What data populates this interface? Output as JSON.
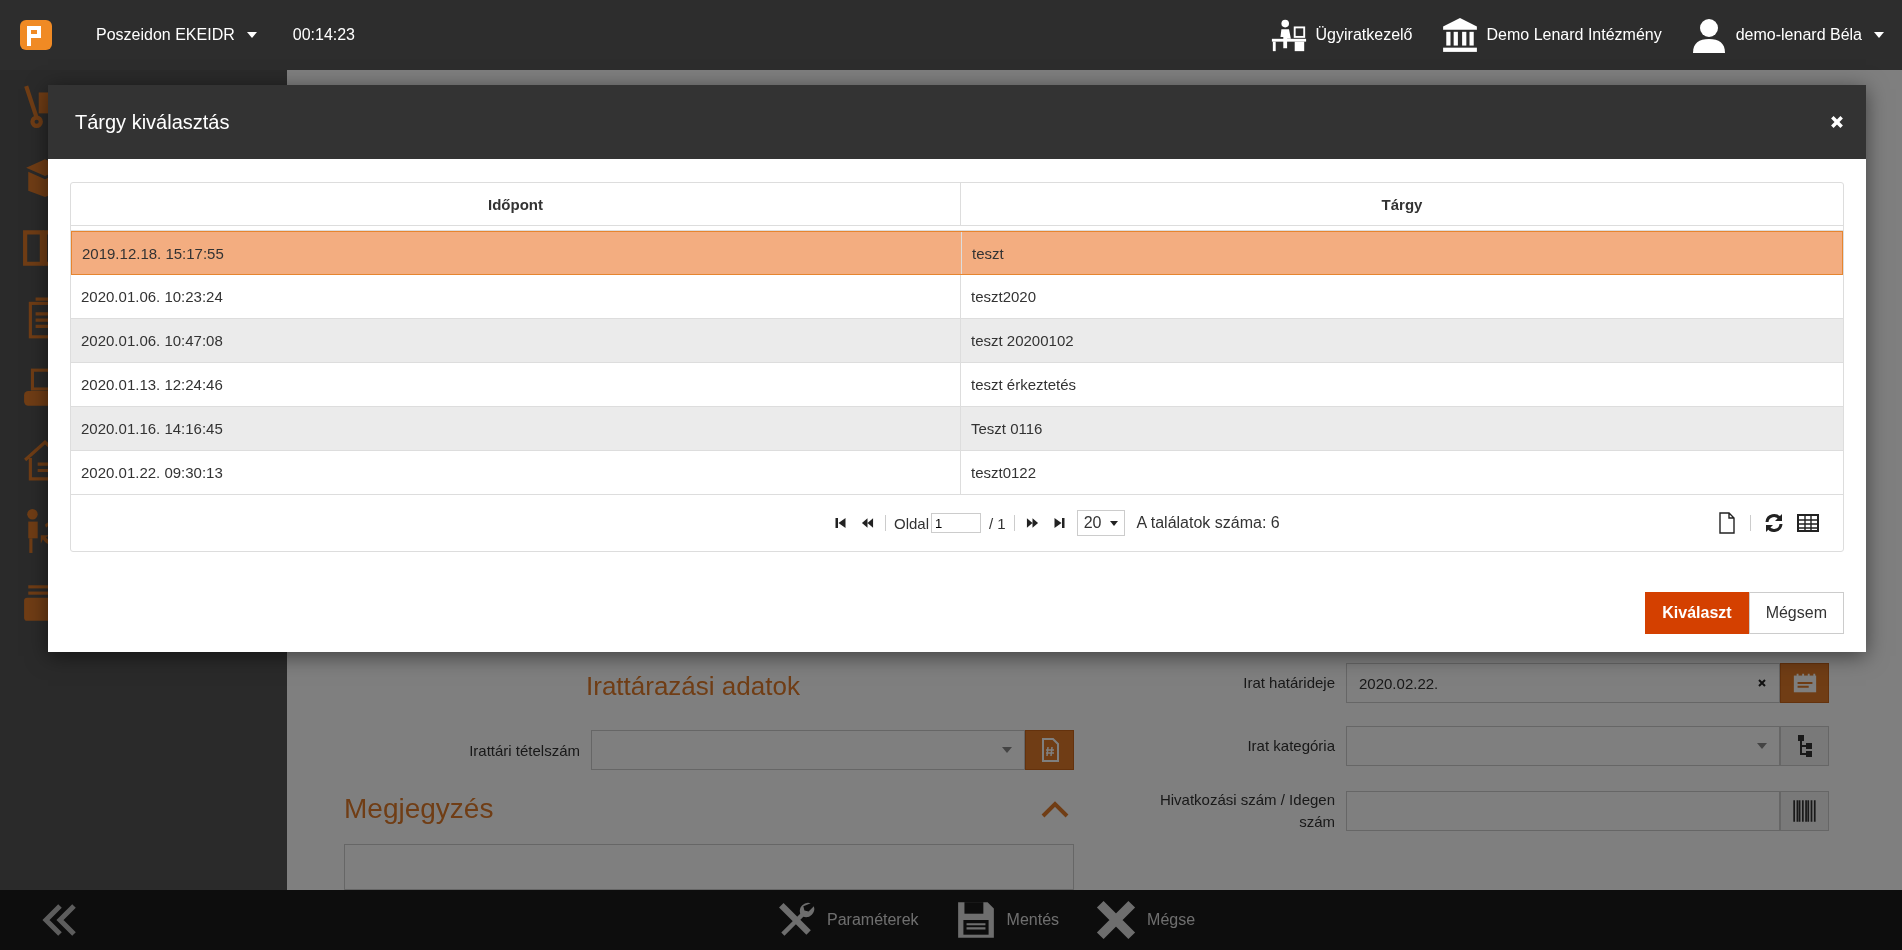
{
  "top_bar": {
    "app_name": "Poszeidon EKEIDR",
    "timer": "00:14:23",
    "module": "Ügyiratkezelő",
    "institution": "Demo Lenard Intézmény",
    "user": "demo-lenard Béla"
  },
  "form": {
    "archive_heading": "Irattárazási adatok",
    "left_fields": [
      {
        "label": "Irattári tételszám",
        "kind": "number-select"
      }
    ],
    "note_heading": "Megjegyzés",
    "right_fields": [
      {
        "label": "Irat határideje",
        "kind": "date",
        "value": "2020.02.22."
      },
      {
        "label": "Irat kategória",
        "kind": "tree-select"
      },
      {
        "label": "Hivatkozási szám / Idegen szám",
        "kind": "barcode"
      }
    ]
  },
  "modal": {
    "title": "Tárgy kiválasztás",
    "columns": [
      "Időpont",
      "Tárgy"
    ],
    "rows": [
      {
        "cells": [
          "2019.12.18. 15:17:55",
          "teszt"
        ],
        "selected": true
      },
      {
        "cells": [
          "2020.01.06. 10:23:24",
          "teszt2020"
        ],
        "selected": false
      },
      {
        "cells": [
          "2020.01.06. 10:47:08",
          "teszt 20200102"
        ],
        "selected": false
      },
      {
        "cells": [
          "2020.01.13. 12:24:46",
          "teszt érkeztetés"
        ],
        "selected": false
      },
      {
        "cells": [
          "2020.01.16. 14:16:45",
          "Teszt 0116"
        ],
        "selected": false
      },
      {
        "cells": [
          "2020.01.22. 09:30:13",
          "teszt0122"
        ],
        "selected": false
      }
    ],
    "pager": {
      "page_label": "Oldal",
      "page": "1",
      "total_pages": "/ 1",
      "page_size": "20",
      "count": "A találatok száma: 6"
    },
    "buttons": [
      {
        "label": "Kiválaszt",
        "kind": "primary"
      },
      {
        "label": "Mégsem",
        "kind": "secondary"
      }
    ]
  },
  "bottom_bar": {
    "buttons": [
      {
        "label": "Paraméterek",
        "kind": "tools"
      },
      {
        "label": "Mentés",
        "kind": "save"
      },
      {
        "label": "Mégse",
        "kind": "cancel"
      }
    ]
  }
}
